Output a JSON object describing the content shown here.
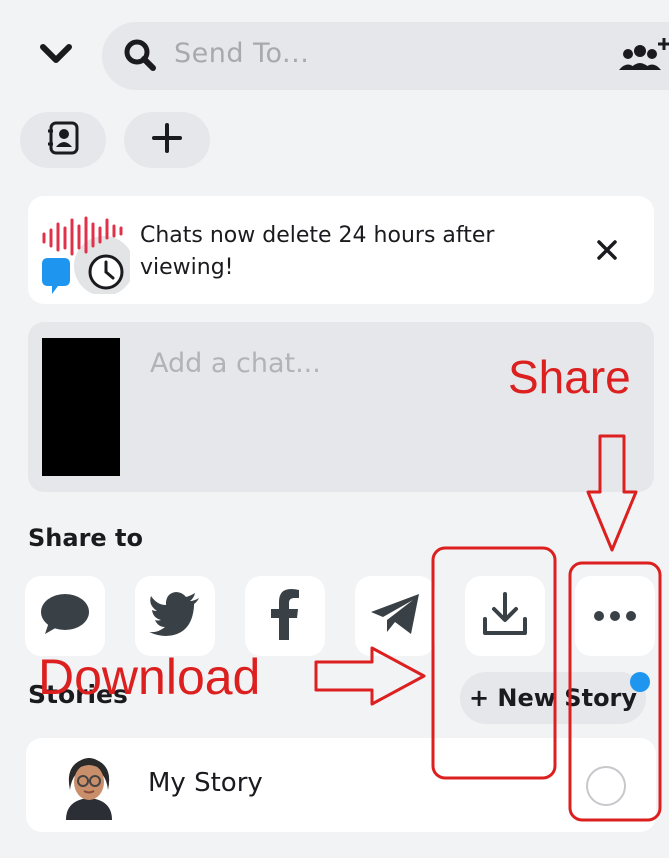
{
  "search": {
    "placeholder": "Send To..."
  },
  "chips": {
    "contacts_icon": "contact-book-icon",
    "add_icon": "plus-icon"
  },
  "banner": {
    "text": "Chats now delete 24 hours after viewing!"
  },
  "chat": {
    "placeholder": "Add a chat..."
  },
  "share": {
    "heading": "Share to",
    "targets": [
      {
        "name": "message",
        "icon": "chat-bubble-icon"
      },
      {
        "name": "twitter",
        "icon": "twitter-icon"
      },
      {
        "name": "facebook",
        "icon": "facebook-icon"
      },
      {
        "name": "telegram",
        "icon": "telegram-icon"
      },
      {
        "name": "download",
        "icon": "download-icon"
      },
      {
        "name": "more",
        "icon": "more-icon"
      }
    ]
  },
  "stories": {
    "heading": "Stories",
    "new_story_label": "+ New Story",
    "my_story_label": "My Story"
  },
  "annotations": {
    "share_label": "Share",
    "download_label": "Download"
  },
  "colors": {
    "accent_blue": "#1e96f0",
    "annotation_red": "#dc1f1f",
    "background": "#f2f3f5",
    "surface": "#ffffff"
  }
}
